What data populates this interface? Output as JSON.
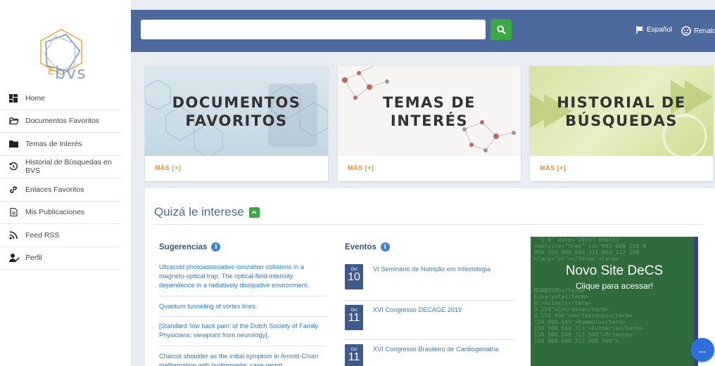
{
  "brand": {
    "logo_text": "bvs",
    "logo_prefix": "E"
  },
  "sidebar": {
    "items": [
      {
        "label": "Home",
        "icon": "dashboard-icon"
      },
      {
        "label": "Documentos Favoritos",
        "icon": "folder-open-icon"
      },
      {
        "label": "Temas de Interés",
        "icon": "folder-icon"
      },
      {
        "label": "Historial de Búsquedas en BVS",
        "icon": "history-icon"
      },
      {
        "label": "Enlaces Favoritos",
        "icon": "link-icon"
      },
      {
        "label": "Mis Publicaciones",
        "icon": "document-icon"
      },
      {
        "label": "Feed RSS",
        "icon": "rss-icon"
      },
      {
        "label": "Perfil",
        "icon": "user-edit-icon"
      }
    ]
  },
  "topbar": {
    "search_placeholder": "",
    "language": "Español",
    "user": "Renato"
  },
  "cards": [
    {
      "title_1": "DOCUMENTOS",
      "title_2": "FAVORITOS",
      "more": "MÁS [+]"
    },
    {
      "title_1": "TEMAS DE",
      "title_2": "INTERÉS",
      "more": "MÁS [+]"
    },
    {
      "title_1": "HISTORIAL DE",
      "title_2": "BÚSQUEDAS",
      "more": "MÁS [+]"
    }
  ],
  "interest": {
    "title": "Quizá le interese",
    "suggestions_title": "Sugerencias",
    "suggestions": [
      "Ultracold photoassociative ionization collisions in a magneto-optical trap: The optical-field-intensity dependence in a radiatively dissipative environment.",
      "Quantum tunneling of vortex lines.",
      "[Standard 'low back pain' of the Dutch Society of Family Physicians; viewpoint from neurology].",
      "Charcot shoulder as the initial symptom in Arnold-Chiari malformation with hydromyelia: case report"
    ],
    "events_title": "Eventos",
    "events": [
      {
        "month": "Oct",
        "day": "10",
        "title": "VI Seminário de Nutrição em Infectologia"
      },
      {
        "month": "Oct",
        "day": "11",
        "title": "XVI Congresso DECAGE 2019"
      },
      {
        "month": "Oct",
        "day": "11",
        "title": "XVI Congresso Brasileiro de Cardiogeriatria"
      }
    ],
    "banner": {
      "line_1": "Novo Site DeCS",
      "line_2": "Clique para acessar!"
    }
  },
  "chat": {
    "label": "..."
  },
  "colors": {
    "topbar": "#4c6a9e",
    "accent_green": "#3aa843",
    "link": "#2e7cc8",
    "more_orange": "#e8912e"
  }
}
